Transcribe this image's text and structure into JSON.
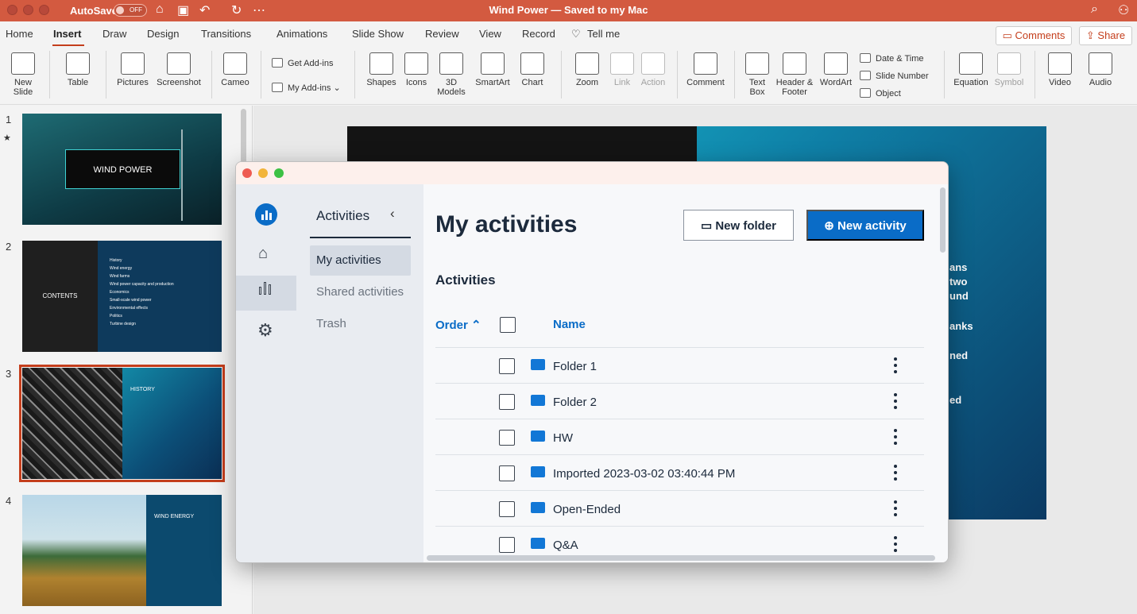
{
  "titlebar": {
    "autosave_label": "AutoSave",
    "autosave_state": "OFF",
    "document_title": "Wind Power — Saved to my Mac",
    "more_icon": "more-horizontal-icon"
  },
  "menubar": {
    "tabs": [
      "Home",
      "Insert",
      "Draw",
      "Design",
      "Transitions",
      "Animations",
      "Slide Show",
      "Review",
      "View",
      "Record"
    ],
    "active_tab": "Insert",
    "tell_me": "Tell me",
    "comments_label": "Comments",
    "share_label": "Share"
  },
  "ribbon": {
    "new_slide": "New Slide",
    "table": "Table",
    "pictures": "Pictures",
    "screenshot": "Screenshot",
    "cameo": "Cameo",
    "get_addins": "Get Add-ins",
    "my_addins": "My Add-ins",
    "shapes": "Shapes",
    "icons": "Icons",
    "models_3d": "3D Models",
    "smartart": "SmartArt",
    "chart": "Chart",
    "zoom": "Zoom",
    "link": "Link",
    "action": "Action",
    "comment": "Comment",
    "text_box": "Text Box",
    "header_footer": "Header & Footer",
    "wordart": "WordArt",
    "date_time": "Date & Time",
    "slide_number": "Slide Number",
    "object": "Object",
    "equation": "Equation",
    "symbol": "Symbol",
    "video": "Video",
    "audio": "Audio"
  },
  "slides": [
    {
      "number": "1",
      "title": "WIND POWER"
    },
    {
      "number": "2",
      "title": "CONTENTS",
      "bullets": [
        "History",
        "Wind energy",
        "Wind farms",
        "Wind power capacity and production",
        "Economics",
        "Small-scale wind power",
        "Environmental effects",
        "Politics",
        "Turbine design"
      ]
    },
    {
      "number": "3",
      "title": "HISTORY"
    },
    {
      "number": "4",
      "title": "WIND ENERGY"
    }
  ],
  "main_slide_fragments": [
    "ans",
    "two",
    "und",
    "anks",
    "ned",
    "ed"
  ],
  "dialog": {
    "sidebar": {
      "heading": "Activities",
      "links": [
        "My activities",
        "Shared activities",
        "Trash"
      ],
      "active": "My activities"
    },
    "content": {
      "title": "My activities",
      "new_folder_label": "New folder",
      "new_activity_label": "New activity",
      "section_title": "Activities",
      "order_label": "Order",
      "name_label": "Name",
      "rows": [
        {
          "name": "Folder 1",
          "icon": "folder-icon"
        },
        {
          "name": "Folder 2",
          "icon": "folder-icon"
        },
        {
          "name": "HW",
          "icon": "shared-folder-icon"
        },
        {
          "name": "Imported 2023-03-02 03:40:44 PM",
          "icon": "folder-icon"
        },
        {
          "name": "Open-Ended",
          "icon": "folder-icon"
        },
        {
          "name": "Q&A",
          "icon": "folder-icon"
        }
      ]
    }
  }
}
